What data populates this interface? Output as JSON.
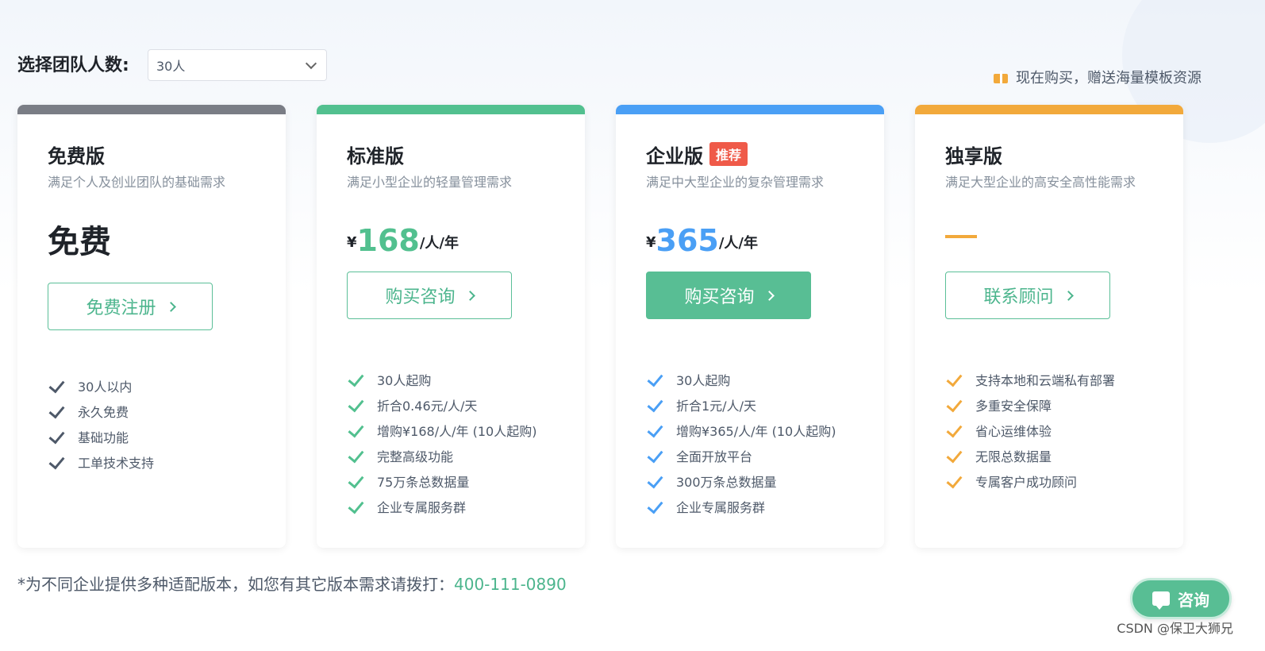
{
  "header": {
    "team_label": "选择团队人数:",
    "team_value": "30人",
    "promo_text": "现在购买，赠送海量模板资源"
  },
  "plans": [
    {
      "name": "免费版",
      "badge": "",
      "desc": "满足个人及创业团队的基础需求",
      "price_text": "免费",
      "button": "免费注册",
      "features": [
        "30人以内",
        "永久免费",
        "基础功能",
        "工单技术支持"
      ],
      "color": "#7a7d85"
    },
    {
      "name": "标准版",
      "badge": "",
      "desc": "满足小型企业的轻量管理需求",
      "currency": "¥",
      "price": "168",
      "unit": "/人/年",
      "button": "购买咨询",
      "features": [
        "30人起购",
        "折合0.46元/人/天",
        "增购¥168/人/年 (10人起购)",
        "完整高级功能",
        "75万条总数据量",
        "企业专属服务群"
      ],
      "color": "#52c08f"
    },
    {
      "name": "企业版",
      "badge": "推荐",
      "desc": "满足中大型企业的复杂管理需求",
      "currency": "¥",
      "price": "365",
      "unit": "/人/年",
      "button": "购买咨询",
      "features": [
        "30人起购",
        "折合1元/人/天",
        "增购¥365/人/年 (10人起购)",
        "全面开放平台",
        "300万条总数据量",
        "企业专属服务群"
      ],
      "color": "#4a9ff5"
    },
    {
      "name": "独享版",
      "badge": "",
      "desc": "满足大型企业的高安全高性能需求",
      "price_text": "—",
      "button": "联系顾问",
      "features": [
        "支持本地和云端私有部署",
        "多重安全保障",
        "省心运维体验",
        "无限总数据量",
        "专属客户成功顾问"
      ],
      "color": "#f2a93b"
    }
  ],
  "footer": {
    "note": "*为不同企业提供多种适配版本，如您有其它版本需求请拨打：",
    "phone": "400-111-0890",
    "consult_label": "咨询",
    "watermark": "CSDN @保卫大狮兄"
  }
}
